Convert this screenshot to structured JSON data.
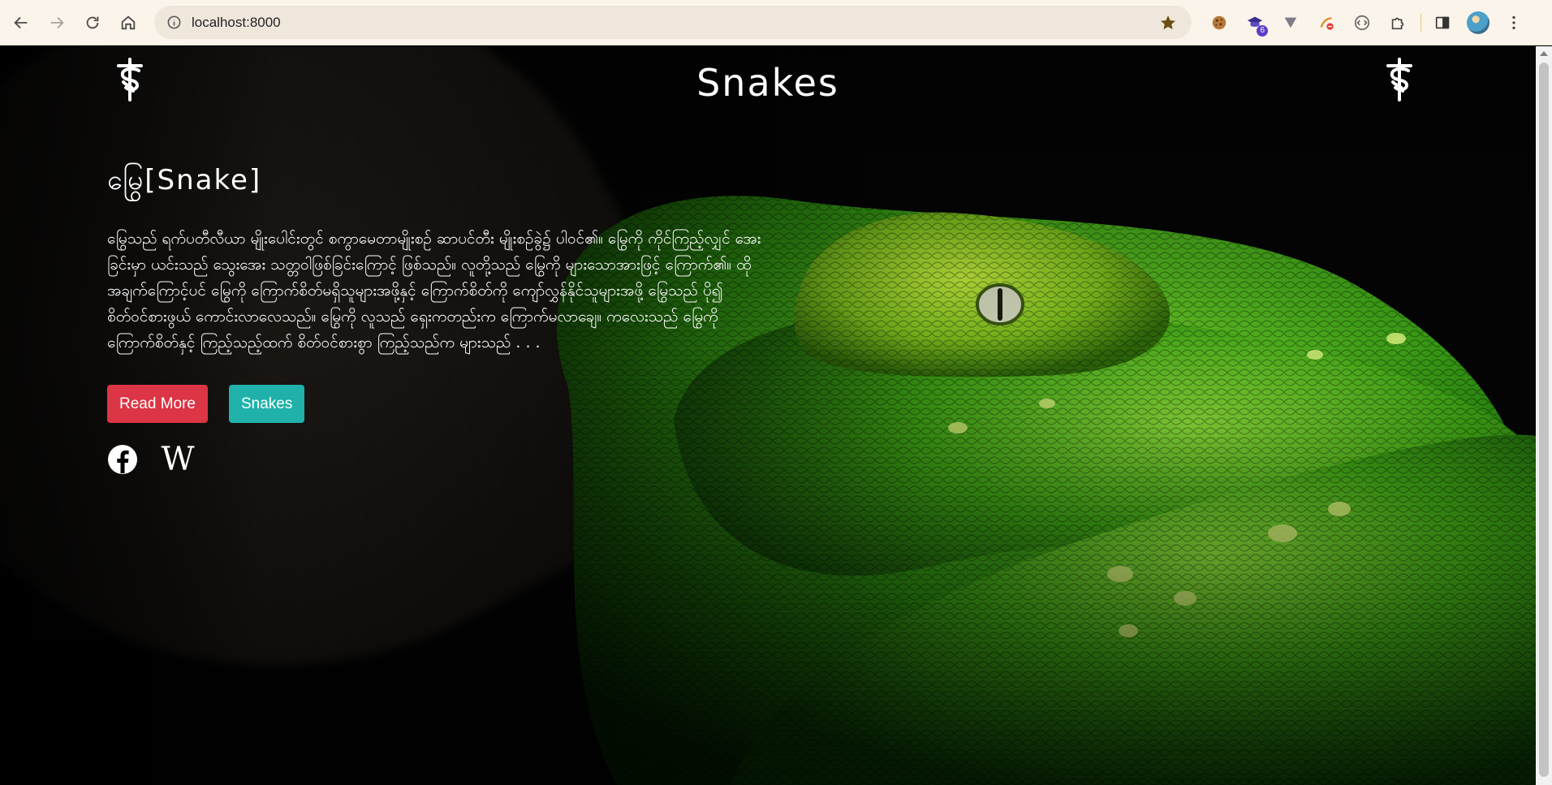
{
  "browser": {
    "url": "localhost:8000",
    "extensions": [
      {
        "icon": "cookie-icon"
      },
      {
        "icon": "graduation-cap-icon",
        "badge": "6"
      },
      {
        "icon": "vee-icon"
      },
      {
        "icon": "blocked-extension-icon"
      },
      {
        "icon": "code-brackets-icon"
      },
      {
        "icon": "puzzle-icon"
      }
    ]
  },
  "header": {
    "title": "Snakes"
  },
  "hero": {
    "heading": "မြွေ[Snake]",
    "description": "မြွေသည် ရက်ပတီလီယာ မျိုးပေါင်းတွင် စကွာမေတာမျိုးစဉ် ဆာပင်တီး မျိုးစဉ်ခွဲ၌ ပါဝင်၏။ မြွေကို ကိုင်ကြည့်လျှင် အေးခြင်းမှာ ယင်းသည် သွေးအေး သတ္တဝါဖြစ်ခြင်းကြောင့် ဖြစ်သည်။ လူတို့သည် မြွေကို များသောအားဖြင့် ကြောက်၏။ ထိုအချက်ကြောင့်ပင် မြွေကို ကြောက်စိတ်မရှိသူများအဖို့နှင့် ကြောက်စိတ်ကို ကျော်လွှန်နိုင်သူများအဖို့ မြွေသည် ပို၍ စိတ်ဝင်စားဖွယ် ကောင်းလာလေသည်။ မြွေကို လူသည် ရှေးကတည်းက ကြောက်မလာချေ။ ကလေးသည် မြွေကို ကြောက်စိတ်နှင့် ကြည့်သည့်ထက် စိတ်ဝင်စားစွာ ကြည့်သည်က များသည် . . .",
    "buttons": {
      "read_more": "Read More",
      "snakes": "Snakes"
    },
    "socials": {
      "wikipedia": "W"
    },
    "colors": {
      "read_more": "#dc3545",
      "snakes": "#20b2aa"
    }
  }
}
